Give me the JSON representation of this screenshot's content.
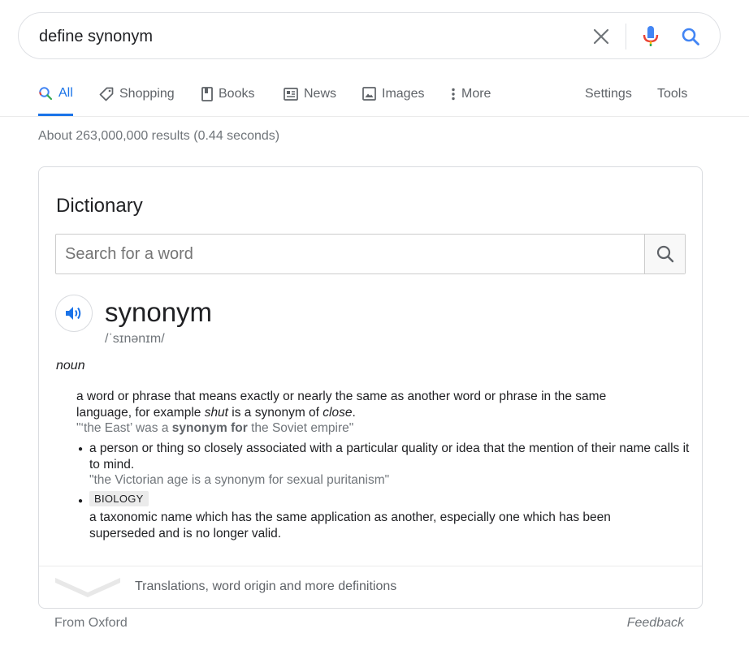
{
  "search": {
    "query": "define synonym"
  },
  "tabs": {
    "all": "All",
    "shopping": "Shopping",
    "books": "Books",
    "news": "News",
    "images": "Images",
    "more": "More",
    "settings": "Settings",
    "tools": "Tools"
  },
  "result_stats": "About 263,000,000 results (0.44 seconds)",
  "dictionary": {
    "title": "Dictionary",
    "search_placeholder": "Search for a word",
    "headword": "synonym",
    "phonetic": "/ˈsɪnənɪm/",
    "part_of_speech": "noun",
    "senses": [
      {
        "def_part1": "a word or phrase that means exactly or nearly the same as another word or phrase in the same language, for example ",
        "def_em1": "shut",
        "def_part2": " is a synonym of ",
        "def_em2": "close",
        "def_part3": ".",
        "example_part1": "\"‘the East’ was a ",
        "example_bold": "synonym for",
        "example_part2": " the Soviet empire\""
      },
      {
        "definition": "a person or thing so closely associated with a particular quality or idea that the mention of their name calls it to mind.",
        "example": "\"the Victorian age is a synonym for sexual puritanism\""
      },
      {
        "tag": "BIOLOGY",
        "definition": "a taxonomic name which has the same application as another, especially one which has been superseded and is no longer valid."
      }
    ],
    "more_link": "Translations, word origin and more definitions"
  },
  "footer": {
    "source": "From Oxford",
    "feedback": "Feedback"
  },
  "colors": {
    "accent_blue": "#1a73e8",
    "text_secondary": "#70757a"
  }
}
